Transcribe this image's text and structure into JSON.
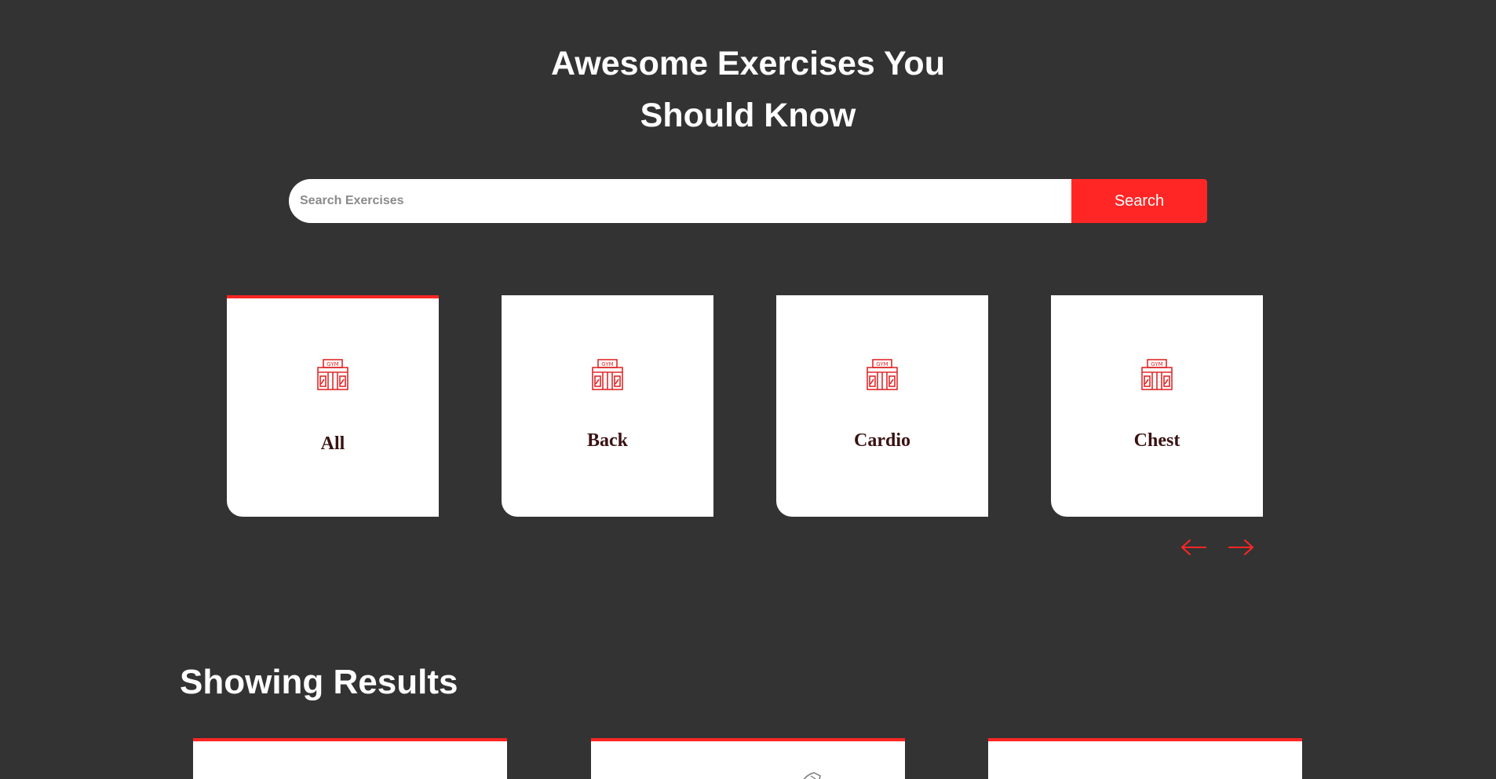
{
  "hero": {
    "title_line1": "Awesome Exercises You",
    "title_line2": "Should Know"
  },
  "search": {
    "placeholder": "Search Exercises",
    "value": "",
    "button_label": "Search"
  },
  "categories": [
    {
      "label": "All",
      "icon": "gym-icon",
      "active": true
    },
    {
      "label": "Back",
      "icon": "gym-icon",
      "active": false
    },
    {
      "label": "Cardio",
      "icon": "gym-icon",
      "active": false
    },
    {
      "label": "Chest",
      "icon": "gym-icon",
      "active": false
    }
  ],
  "pagination": {
    "prev_icon": "left-arrow-icon",
    "next_icon": "right-arrow-icon"
  },
  "results": {
    "title": "Showing Results"
  },
  "colors": {
    "background": "#333333",
    "accent": "#ff2625",
    "card": "#ffffff",
    "label": "#3a1212"
  }
}
